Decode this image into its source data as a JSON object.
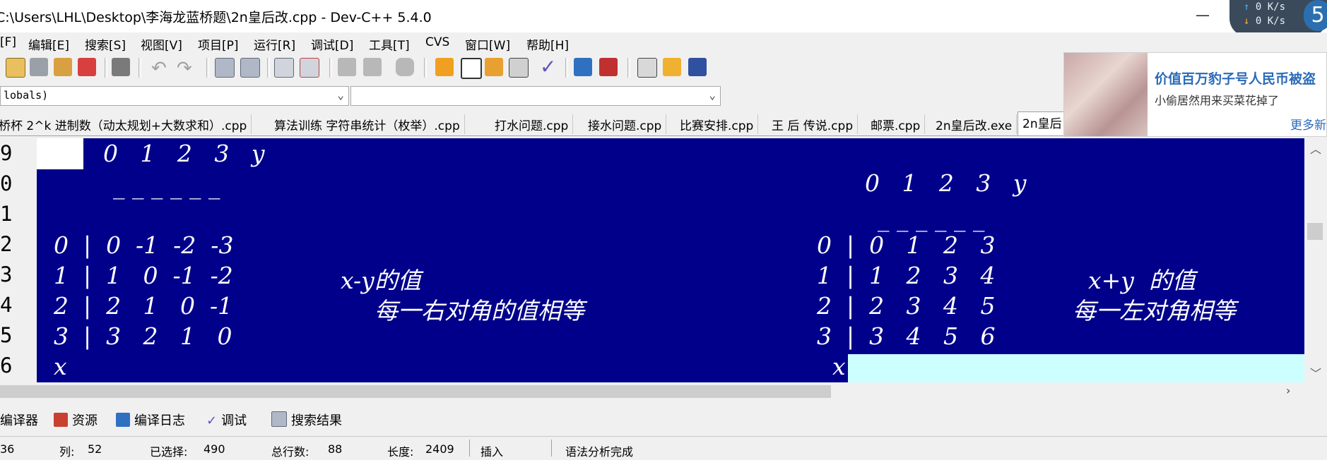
{
  "window": {
    "title": "C:\\Users\\LHL\\Desktop\\李海龙蓝桥题\\2n皇后改.cpp - Dev-C++ 5.4.0",
    "minimize": "—",
    "maximize": "☐"
  },
  "net_monitor": {
    "up": "0 K/s",
    "down": "0 K/s",
    "badge": "5"
  },
  "menu": [
    "[F]",
    "编辑[E]",
    "搜索[S]",
    "视图[V]",
    "项目[P]",
    "运行[R]",
    "调试[D]",
    "工具[T]",
    "CVS",
    "窗口[W]",
    "帮助[H]"
  ],
  "combos": {
    "left": "lobals)",
    "right": ""
  },
  "tabs": [
    "桥杯 2^k 进制数（动太规划+大数求和）.cpp",
    "算法训练 字符串统计（枚举）.cpp",
    "打水问题.cpp",
    "接水问题.cpp",
    "比赛安排.cpp",
    "王 后 传说.cpp",
    "邮票.cpp",
    "2n皇后改.exe",
    "2n皇后"
  ],
  "ad": {
    "title": "价值百万豹子号人民币被盗",
    "subtitle": "小偷居然用来买菜花掉了",
    "more": "更多新"
  },
  "line_numbers": [
    "9",
    "0",
    "1",
    "2",
    "3",
    "4",
    "5",
    "6"
  ],
  "editor": {
    "left_header": "0   1   2   3   y",
    "left_underline": "_ _ _ _ _ _",
    "left_rows": [
      "0  |  0  -1  -2  -3",
      "1  |  1   0  -1  -2",
      "2  |  2   1   0  -1",
      "3  |  3   2   1   0"
    ],
    "left_x": "x",
    "left_note1": "x-y的值",
    "left_note2": "每一右对角的值相等",
    "right_header": "0   1   2   3   y",
    "right_underline": "_ _ _ _ _ _",
    "right_rows": [
      "0  |  0   1   2   3",
      "1  |  1   2   3   4",
      "2  |  2   3   4   5",
      "3  |  3   4   5   6"
    ],
    "right_x": "x",
    "right_note1": "x+y  的值",
    "right_note2": "每一左对角相等"
  },
  "bottom_tabs": [
    "编译器",
    "资源",
    "编译日志",
    "调试",
    "搜索结果"
  ],
  "status": {
    "line_value": "36",
    "col_label": "列:",
    "col_value": "52",
    "sel_label": "已选择:",
    "sel_value": "490",
    "total_label": "总行数:",
    "total_value": "88",
    "len_label": "长度:",
    "len_value": "2409",
    "mode": "插入",
    "parse": "语法分析完成"
  },
  "colors": {
    "editor_bg": "#00008b",
    "selection_right": "#ccffff",
    "ad_title": "#2a6ab8"
  }
}
